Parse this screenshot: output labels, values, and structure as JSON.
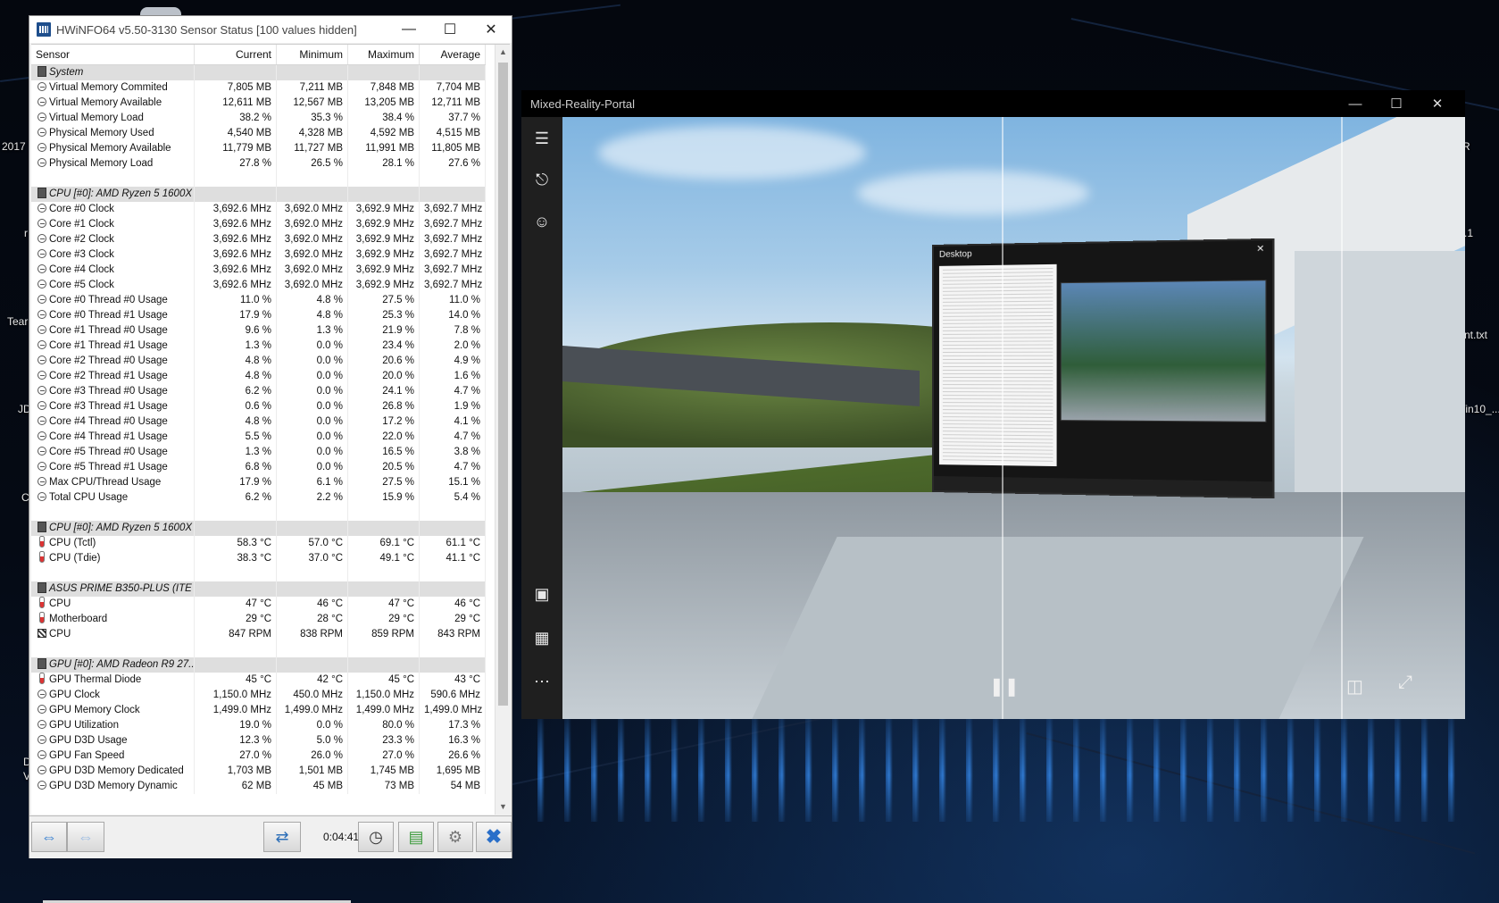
{
  "hwinfo": {
    "title": "HWiNFO64 v5.50-3130 Sensor Status [100 values hidden]",
    "columns": [
      "Sensor",
      "Current",
      "Minimum",
      "Maximum",
      "Average"
    ],
    "groups": [
      {
        "name": "System",
        "rows": [
          {
            "icon": "clock-icon",
            "label": "Virtual Memory Commited",
            "current": "7,805 MB",
            "minimum": "7,211 MB",
            "maximum": "7,848 MB",
            "average": "7,704 MB"
          },
          {
            "icon": "clock-icon",
            "label": "Virtual Memory Available",
            "current": "12,611 MB",
            "minimum": "12,567 MB",
            "maximum": "13,205 MB",
            "average": "12,711 MB"
          },
          {
            "icon": "clock-icon",
            "label": "Virtual Memory Load",
            "current": "38.2 %",
            "minimum": "35.3 %",
            "maximum": "38.4 %",
            "average": "37.7 %"
          },
          {
            "icon": "clock-icon",
            "label": "Physical Memory Used",
            "current": "4,540 MB",
            "minimum": "4,328 MB",
            "maximum": "4,592 MB",
            "average": "4,515 MB"
          },
          {
            "icon": "clock-icon",
            "label": "Physical Memory Available",
            "current": "11,779 MB",
            "minimum": "11,727 MB",
            "maximum": "11,991 MB",
            "average": "11,805 MB"
          },
          {
            "icon": "clock-icon",
            "label": "Physical Memory Load",
            "current": "27.8 %",
            "minimum": "26.5 %",
            "maximum": "28.1 %",
            "average": "27.6 %"
          }
        ]
      },
      {
        "name": "CPU [#0]: AMD Ryzen 5 1600X",
        "rows": [
          {
            "icon": "clock-icon",
            "label": "Core #0 Clock",
            "current": "3,692.6 MHz",
            "minimum": "3,692.0 MHz",
            "maximum": "3,692.9 MHz",
            "average": "3,692.7 MHz"
          },
          {
            "icon": "clock-icon",
            "label": "Core #1 Clock",
            "current": "3,692.6 MHz",
            "minimum": "3,692.0 MHz",
            "maximum": "3,692.9 MHz",
            "average": "3,692.7 MHz"
          },
          {
            "icon": "clock-icon",
            "label": "Core #2 Clock",
            "current": "3,692.6 MHz",
            "minimum": "3,692.0 MHz",
            "maximum": "3,692.9 MHz",
            "average": "3,692.7 MHz"
          },
          {
            "icon": "clock-icon",
            "label": "Core #3 Clock",
            "current": "3,692.6 MHz",
            "minimum": "3,692.0 MHz",
            "maximum": "3,692.9 MHz",
            "average": "3,692.7 MHz"
          },
          {
            "icon": "clock-icon",
            "label": "Core #4 Clock",
            "current": "3,692.6 MHz",
            "minimum": "3,692.0 MHz",
            "maximum": "3,692.9 MHz",
            "average": "3,692.7 MHz"
          },
          {
            "icon": "clock-icon",
            "label": "Core #5 Clock",
            "current": "3,692.6 MHz",
            "minimum": "3,692.0 MHz",
            "maximum": "3,692.9 MHz",
            "average": "3,692.7 MHz"
          },
          {
            "icon": "clock-icon",
            "label": "Core #0 Thread #0 Usage",
            "current": "11.0 %",
            "minimum": "4.8 %",
            "maximum": "27.5 %",
            "average": "11.0 %"
          },
          {
            "icon": "clock-icon",
            "label": "Core #0 Thread #1 Usage",
            "current": "17.9 %",
            "minimum": "4.8 %",
            "maximum": "25.3 %",
            "average": "14.0 %"
          },
          {
            "icon": "clock-icon",
            "label": "Core #1 Thread #0 Usage",
            "current": "9.6 %",
            "minimum": "1.3 %",
            "maximum": "21.9 %",
            "average": "7.8 %"
          },
          {
            "icon": "clock-icon",
            "label": "Core #1 Thread #1 Usage",
            "current": "1.3 %",
            "minimum": "0.0 %",
            "maximum": "23.4 %",
            "average": "2.0 %"
          },
          {
            "icon": "clock-icon",
            "label": "Core #2 Thread #0 Usage",
            "current": "4.8 %",
            "minimum": "0.0 %",
            "maximum": "20.6 %",
            "average": "4.9 %"
          },
          {
            "icon": "clock-icon",
            "label": "Core #2 Thread #1 Usage",
            "current": "4.8 %",
            "minimum": "0.0 %",
            "maximum": "20.0 %",
            "average": "1.6 %"
          },
          {
            "icon": "clock-icon",
            "label": "Core #3 Thread #0 Usage",
            "current": "6.2 %",
            "minimum": "0.0 %",
            "maximum": "24.1 %",
            "average": "4.7 %"
          },
          {
            "icon": "clock-icon",
            "label": "Core #3 Thread #1 Usage",
            "current": "0.6 %",
            "minimum": "0.0 %",
            "maximum": "26.8 %",
            "average": "1.9 %"
          },
          {
            "icon": "clock-icon",
            "label": "Core #4 Thread #0 Usage",
            "current": "4.8 %",
            "minimum": "0.0 %",
            "maximum": "17.2 %",
            "average": "4.1 %"
          },
          {
            "icon": "clock-icon",
            "label": "Core #4 Thread #1 Usage",
            "current": "5.5 %",
            "minimum": "0.0 %",
            "maximum": "22.0 %",
            "average": "4.7 %"
          },
          {
            "icon": "clock-icon",
            "label": "Core #5 Thread #0 Usage",
            "current": "1.3 %",
            "minimum": "0.0 %",
            "maximum": "16.5 %",
            "average": "3.8 %"
          },
          {
            "icon": "clock-icon",
            "label": "Core #5 Thread #1 Usage",
            "current": "6.8 %",
            "minimum": "0.0 %",
            "maximum": "20.5 %",
            "average": "4.7 %"
          },
          {
            "icon": "clock-icon",
            "label": "Max CPU/Thread Usage",
            "current": "17.9 %",
            "minimum": "6.1 %",
            "maximum": "27.5 %",
            "average": "15.1 %"
          },
          {
            "icon": "clock-icon",
            "label": "Total CPU Usage",
            "current": "6.2 %",
            "minimum": "2.2 %",
            "maximum": "15.9 %",
            "average": "5.4 %"
          }
        ]
      },
      {
        "name": "CPU [#0]: AMD Ryzen 5 1600X",
        "rows": [
          {
            "icon": "thermometer-icon",
            "label": "CPU (Tctl)",
            "current": "58.3 °C",
            "minimum": "57.0 °C",
            "maximum": "69.1 °C",
            "average": "61.1 °C"
          },
          {
            "icon": "thermometer-icon",
            "label": "CPU (Tdie)",
            "current": "38.3 °C",
            "minimum": "37.0 °C",
            "maximum": "49.1 °C",
            "average": "41.1 °C"
          }
        ]
      },
      {
        "name": "ASUS PRIME B350-PLUS (ITE I...",
        "rows": [
          {
            "icon": "thermometer-icon",
            "label": "CPU",
            "current": "47 °C",
            "minimum": "46 °C",
            "maximum": "47 °C",
            "average": "46 °C"
          },
          {
            "icon": "thermometer-icon",
            "label": "Motherboard",
            "current": "29 °C",
            "minimum": "28 °C",
            "maximum": "29 °C",
            "average": "29 °C"
          },
          {
            "icon": "fan-icon",
            "label": "CPU",
            "current": "847 RPM",
            "minimum": "838 RPM",
            "maximum": "859 RPM",
            "average": "843 RPM"
          }
        ]
      },
      {
        "name": "GPU [#0]: AMD Radeon R9 27...",
        "rows": [
          {
            "icon": "thermometer-icon",
            "label": "GPU Thermal Diode",
            "current": "45 °C",
            "minimum": "42 °C",
            "maximum": "45 °C",
            "average": "43 °C"
          },
          {
            "icon": "clock-icon",
            "label": "GPU Clock",
            "current": "1,150.0 MHz",
            "minimum": "450.0 MHz",
            "maximum": "1,150.0 MHz",
            "average": "590.6 MHz"
          },
          {
            "icon": "clock-icon",
            "label": "GPU Memory Clock",
            "current": "1,499.0 MHz",
            "minimum": "1,499.0 MHz",
            "maximum": "1,499.0 MHz",
            "average": "1,499.0 MHz"
          },
          {
            "icon": "clock-icon",
            "label": "GPU Utilization",
            "current": "19.0 %",
            "minimum": "0.0 %",
            "maximum": "80.0 %",
            "average": "17.3 %"
          },
          {
            "icon": "clock-icon",
            "label": "GPU D3D Usage",
            "current": "12.3 %",
            "minimum": "5.0 %",
            "maximum": "23.3 %",
            "average": "16.3 %"
          },
          {
            "icon": "clock-icon",
            "label": "GPU Fan Speed",
            "current": "27.0 %",
            "minimum": "26.0 %",
            "maximum": "27.0 %",
            "average": "26.6 %"
          },
          {
            "icon": "clock-icon",
            "label": "GPU D3D Memory Dedicated",
            "current": "1,703 MB",
            "minimum": "1,501 MB",
            "maximum": "1,745 MB",
            "average": "1,695 MB"
          },
          {
            "icon": "clock-icon",
            "label": "GPU D3D Memory Dynamic",
            "current": "62 MB",
            "minimum": "45 MB",
            "maximum": "73 MB",
            "average": "54 MB"
          }
        ]
      }
    ],
    "toolbar": {
      "elapsed": "0:04:41",
      "buttons": [
        "arrows-left-right-icon",
        "arrows-left-right-disabled-icon",
        "network-icon",
        "clock-icon",
        "report-add-icon",
        "settings-gear-icon",
        "close-x-icon"
      ]
    }
  },
  "mrp": {
    "title": "Mixed-Reality-Portal",
    "sidebar_icons": [
      "hamburger-menu-icon",
      "headset-icon",
      "mixed-reality-icon",
      "photo-icon",
      "store-icon",
      "more-dots-icon"
    ],
    "virtual_desktop_title": "Desktop",
    "controls": [
      "pause-icon",
      "split-view-icon",
      "expand-icon"
    ]
  },
  "desktop": {
    "fragments": [
      "2017",
      "r",
      "Tear",
      "JD",
      "C",
      "D",
      "V",
      "R",
      ".1",
      "nt.txt",
      "/in10_..."
    ]
  },
  "colors": {
    "hw_group_bg": "#dedede",
    "accent_blue": "#2d7bd1",
    "close_red": "#2a6fc9"
  }
}
